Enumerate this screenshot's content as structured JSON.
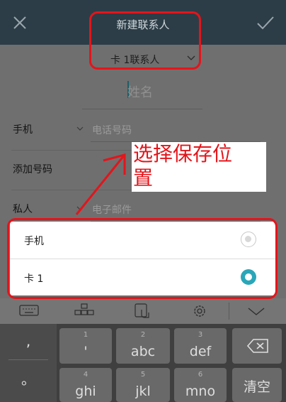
{
  "header": {
    "title": "新建联系人",
    "account": "卡 1联系人"
  },
  "form": {
    "name_placeholder": "姓名",
    "rows": [
      {
        "label": "手机",
        "placeholder": "电话号码"
      },
      {
        "label": "添加号码"
      },
      {
        "label": "私人",
        "placeholder": "电子邮件"
      }
    ]
  },
  "annotation": {
    "line1": "选择保存位",
    "line2": "置"
  },
  "picker": {
    "options": [
      {
        "label": "手机",
        "selected": false
      },
      {
        "label": "卡 1",
        "selected": true
      }
    ]
  },
  "keyboard": {
    "symbols": [
      ",",
      "。"
    ],
    "keys": [
      {
        "num": "1",
        "label": "'"
      },
      {
        "num": "2",
        "label": "abc"
      },
      {
        "num": "3",
        "label": "def"
      },
      {
        "num": "4",
        "label": "ghi"
      },
      {
        "num": "5",
        "label": "jkl"
      },
      {
        "num": "6",
        "label": "mno"
      }
    ],
    "clear_label": "清空"
  },
  "colors": {
    "accent": "#2aa6b9",
    "annotation_red": "#e3151b",
    "topbar": "#2c3d47"
  }
}
